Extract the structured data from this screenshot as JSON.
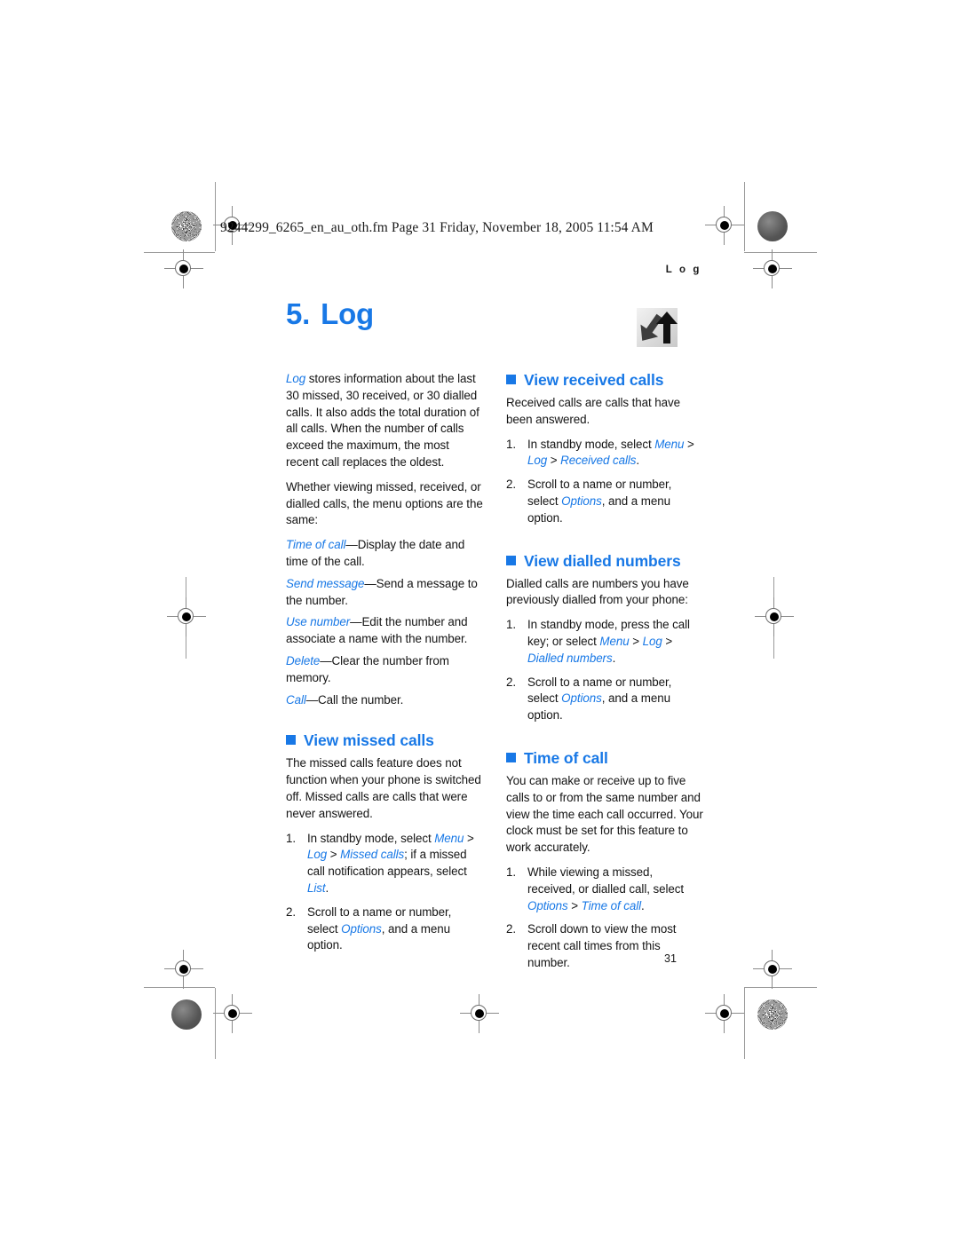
{
  "print_marks": {
    "filename_line": "9244299_6265_en_au_oth.fm  Page 31  Friday, November 18, 2005  11:54 AM"
  },
  "header": {
    "running_head": "L o g"
  },
  "chapter": {
    "number": "5.",
    "title": "Log",
    "icon": "call-log-arrows-icon"
  },
  "left_column": {
    "intro_1": {
      "lead": "Log",
      "rest": " stores information about the last 30 missed, 30 received, or 30 dialled calls. It also adds the total duration of all calls. When the number of calls exceed the maximum, the most recent call replaces the oldest."
    },
    "intro_2": "Whether viewing missed, received, or dialled calls, the menu options are the same:",
    "options": [
      {
        "term": "Time of call",
        "desc": "—Display the date and time of the call."
      },
      {
        "term": "Send message",
        "desc": "—Send a message to the number."
      },
      {
        "term": "Use number",
        "desc": "—Edit the number and associate a name with the number."
      },
      {
        "term": "Delete",
        "desc": "—Clear the number from memory."
      },
      {
        "term": "Call",
        "desc": "—Call the number."
      }
    ],
    "missed_calls": {
      "heading": "View missed calls",
      "intro": "The missed calls feature does not function when your phone is switched off. Missed calls are calls that were never answered.",
      "step1": {
        "a": "In standby mode, select ",
        "menu": "Menu",
        "b": " > ",
        "log": "Log",
        "c": " > ",
        "missed": "Missed calls",
        "d": "; if a missed call notification appears, select ",
        "list": "List",
        "e": "."
      },
      "step2": {
        "a": "Scroll to a name or number, select ",
        "options": "Options",
        "b": ", and a menu option."
      }
    }
  },
  "right_column": {
    "received_calls": {
      "heading": "View received calls",
      "intro": "Received calls are calls that have been answered.",
      "step1": {
        "a": "In standby mode, select ",
        "menu": "Menu",
        "b": " > ",
        "log": "Log",
        "c": " > ",
        "received": "Received calls",
        "d": "."
      },
      "step2": {
        "a": "Scroll to a name or number, select ",
        "options": "Options",
        "b": ", and a menu option."
      }
    },
    "dialled_numbers": {
      "heading": "View dialled numbers",
      "intro": "Dialled calls are numbers you have previously dialled from your phone:",
      "step1": {
        "a": "In standby mode, press the call key; or select ",
        "menu": "Menu",
        "b": " > ",
        "log": "Log",
        "c": " > ",
        "dialled": "Dialled numbers",
        "d": "."
      },
      "step2": {
        "a": "Scroll to a name or number, select ",
        "options": "Options",
        "b": ", and a menu option."
      }
    },
    "time_of_call": {
      "heading": "Time of call",
      "intro": "You can make or receive up to five calls to or from the same number and view the time each call occurred. Your clock must be set for this feature to work accurately.",
      "step1": {
        "a": "While viewing a missed, received, or dialled call, select ",
        "options": "Options",
        "b": " > ",
        "toc": "Time of call",
        "c": "."
      },
      "step2": "Scroll down to view the most recent call times from this number."
    }
  },
  "footer": {
    "page_number": "31"
  },
  "colors": {
    "accent_blue": "#1878e6",
    "text_black": "#141414"
  }
}
